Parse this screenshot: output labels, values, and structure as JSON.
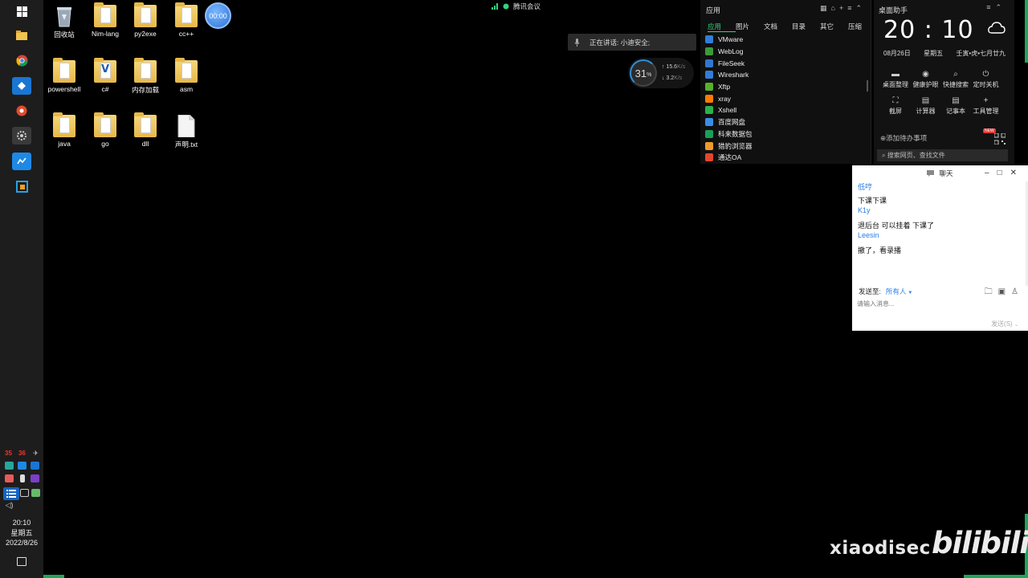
{
  "colors": {
    "accent": "#1aa85a",
    "taskbar": "#1d1d1d",
    "link": "#2a7de1"
  },
  "desktop": {
    "icons": [
      {
        "label": "回收站",
        "icon": "recycle-bin-icon"
      },
      {
        "label": "Nim-lang",
        "icon": "folder-icon"
      },
      {
        "label": "py2exe",
        "icon": "folder-icon"
      },
      {
        "label": "cc++",
        "icon": "folder-icon"
      },
      {
        "label": "powershell",
        "icon": "folder-icon"
      },
      {
        "label": "c#",
        "icon": "folder-icon",
        "badge": "V"
      },
      {
        "label": "内存加载",
        "icon": "folder-icon"
      },
      {
        "label": "asm",
        "icon": "folder-icon"
      },
      {
        "label": "java",
        "icon": "folder-icon"
      },
      {
        "label": "go",
        "icon": "folder-icon"
      },
      {
        "label": "dll",
        "icon": "folder-icon"
      },
      {
        "label": "声明.txt",
        "icon": "text-file-icon"
      }
    ]
  },
  "timer": {
    "value": "00:00"
  },
  "meeting": {
    "title": "腾讯会议",
    "speaking": "正在讲话: 小迪安全;"
  },
  "network": {
    "cpu": "31",
    "cpu_unit": "%",
    "up": "15.6",
    "down": "3.2",
    "unit": "K/s"
  },
  "app_panel": {
    "title": "应用",
    "tabs": [
      "应用",
      "图片",
      "文档",
      "目录",
      "其它",
      "压缩"
    ],
    "items": [
      "VMware",
      "WebLog",
      "FileSeek",
      "Wireshark",
      "Xftp",
      "xray",
      "Xshell",
      "百度网盘",
      "科来数据包",
      "猎豹浏览器",
      "通达OA"
    ]
  },
  "helper": {
    "title": "桌面助手",
    "time": "20 : 10",
    "date": "08月26日",
    "weekday": "星期五",
    "lunar": "壬寅•虎•七月廿九",
    "buttons": [
      "桌面整理",
      "健康护眼",
      "快捷搜索",
      "定时关机",
      "截屏",
      "计算器",
      "记事本",
      "工具管理"
    ],
    "todo": "添加待办事项",
    "search": "搜索网页、查找文件",
    "new_badge": "NEW"
  },
  "chat": {
    "title": "聊天",
    "messages": [
      {
        "name": "低哼",
        "text": "下课下课"
      },
      {
        "name": "K1y",
        "text": "退后台 可以挂着 下课了"
      },
      {
        "name": "Leesin",
        "text": "撤了，看录播"
      }
    ],
    "send_to_label": "发送至:",
    "send_to_value": "所有人",
    "input_placeholder": "请输入消息...",
    "send_button": "发送(S)"
  },
  "taskbar": {
    "clock_time": "20:10",
    "clock_day": "星期五",
    "clock_date": "2022/8/26",
    "tray_nums": [
      "35",
      "36"
    ]
  },
  "watermark": {
    "text": "xiaodisec",
    "logo": "bilibili"
  }
}
